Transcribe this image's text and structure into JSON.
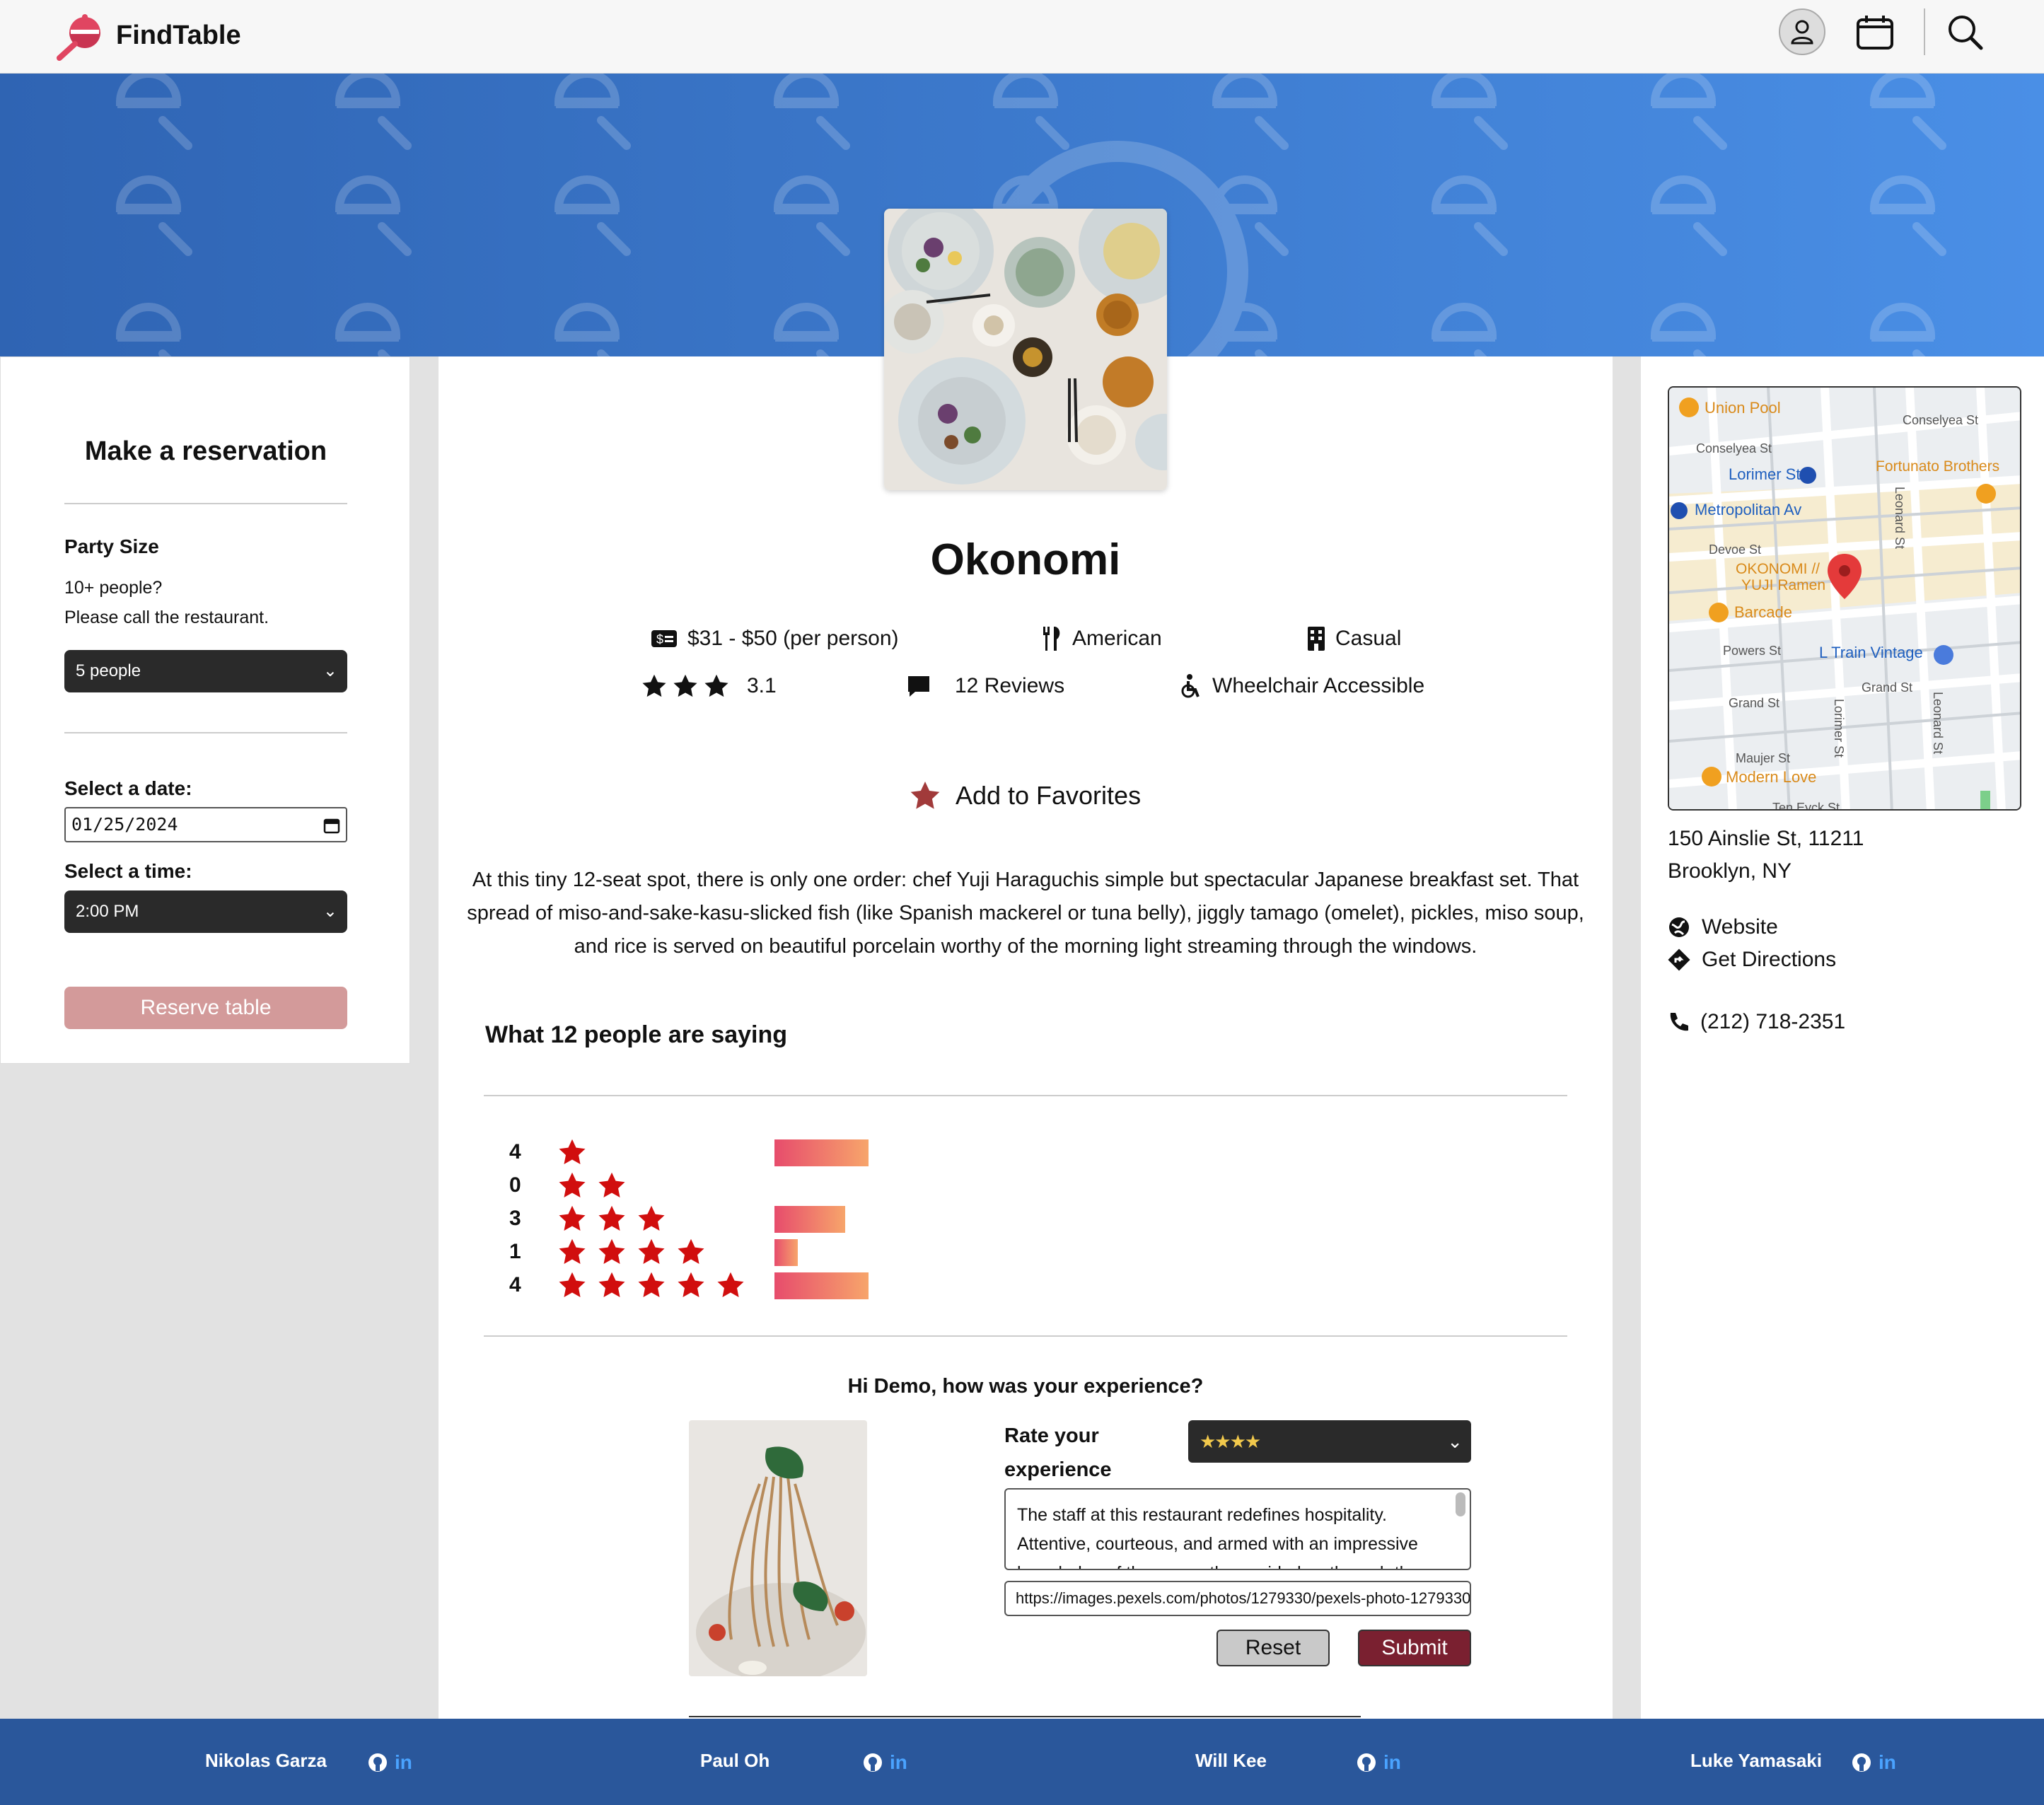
{
  "header": {
    "app_name": "FindTable",
    "icons": [
      "profile-icon",
      "calendar-icon",
      "search-icon"
    ]
  },
  "reservation": {
    "title": "Make a reservation",
    "party_label": "Party Size",
    "party_note_1": "10+ people?",
    "party_note_2": "Please call the restaurant.",
    "party_value": "5 people",
    "date_label": "Select a date:",
    "date_value": "01/25/2024",
    "time_label": "Select a time:",
    "time_value": "2:00 PM",
    "reserve_button": "Reserve table"
  },
  "restaurant": {
    "name": "Okonomi",
    "price": "$31 - $50 (per person)",
    "cuisine": "American",
    "style": "Casual",
    "rating": "3.1",
    "rating_stars": 3,
    "reviews": "12 Reviews",
    "accessibility": "Wheelchair Accessible",
    "favorite": "Add to Favorites",
    "description": "At this tiny 12-seat spot, there is only one order: chef Yuji Haraguchis simple but spectacular Japanese breakfast set. That spread of miso-and-sake-kasu-slicked fish (like Spanish mackerel or tuna belly), jiggly tamago (omelet), pickles, miso soup, and rice is served on beautiful porcelain worthy of the morning light streaming through the windows."
  },
  "ratings": {
    "heading": "What 12 people are saying",
    "rows": [
      {
        "stars": 1,
        "count": "4",
        "fraction": 0.333
      },
      {
        "stars": 2,
        "count": "0",
        "fraction": 0.0
      },
      {
        "stars": 3,
        "count": "3",
        "fraction": 0.25
      },
      {
        "stars": 4,
        "count": "1",
        "fraction": 0.083
      },
      {
        "stars": 5,
        "count": "4",
        "fraction": 0.333
      }
    ],
    "star_color": "#d10e0e"
  },
  "review_form": {
    "greeting": "Hi Demo, how was your experience?",
    "rate_label_1": "Rate your",
    "rate_label_2": "experience",
    "rating_value": "★★★★",
    "review_text": "The staff at this restaurant redefines hospitality. Attentive, courteous, and armed with an impressive knowledge of the menu, they guided us through the",
    "image_url": "https://images.pexels.com/photos/1279330/pexels-photo-1279330",
    "reset_button": "Reset",
    "submit_button": "Submit"
  },
  "location": {
    "map_labels": [
      "Union Pool",
      "Conselyea St",
      "Conselyea St",
      "Lorimer St",
      "Fortunato Brothers",
      "Metropolitan Av",
      "Devoe St",
      "OKONOMI //",
      "YUJI Ramen",
      "Barcade",
      "Powers St",
      "L Train Vintage",
      "Grand St",
      "Grand St",
      "Maujer St",
      "Modern Love",
      "Leonard St",
      "Lorimer St",
      "Leonard St",
      "Ten Eyck St"
    ],
    "address_1": "150 Ainslie St, 11211",
    "address_2": "Brooklyn, NY",
    "website": "Website",
    "directions": "Get Directions",
    "phone": "(212) 718-2351"
  },
  "footer": {
    "developers": [
      "Nikolas Garza",
      "Paul Oh",
      "Will Kee",
      "Luke Yamasaki"
    ],
    "linkedin_label": "in"
  },
  "colors": {
    "hero_start": "#2f64b3",
    "hero_end": "#4a8fe6",
    "footer": "#2a579b",
    "submit": "#7a2030",
    "reserve": "#d39a9a"
  }
}
